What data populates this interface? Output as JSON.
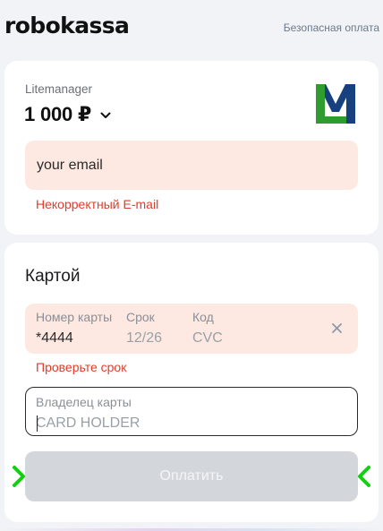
{
  "header": {
    "logo_text": "robokassa",
    "secure_text": "Безопасная оплата"
  },
  "order": {
    "merchant": "Litemanager",
    "amount": "1 000 ₽"
  },
  "email": {
    "placeholder": "your email",
    "error": "Некорректный E-mail"
  },
  "card": {
    "title": "Картой",
    "number_label": "Номер карты",
    "number_value": "*4444",
    "expiry_label": "Срок",
    "expiry_value": "12/26",
    "cvc_label": "Код",
    "cvc_placeholder": "CVC",
    "error": "Проверьте срок",
    "holder_label": "Владелец карты",
    "holder_placeholder": "CARD HOLDER"
  },
  "pay_button": "Оплатить",
  "colors": {
    "error_text": "#e23c29",
    "field_error_bg": "#fde9e1",
    "button_disabled": "#d3d7dc",
    "arrow_green": "#10d010",
    "logo_blue": "#17407e",
    "logo_green": "#2f9c2f"
  },
  "icons": {
    "amount_toggle": "chevron-down-icon",
    "merchant_logo": "merchant-logo-icon",
    "clear_card": "close-icon",
    "annotation_left": "chevron-right-icon",
    "annotation_right": "chevron-left-icon"
  }
}
